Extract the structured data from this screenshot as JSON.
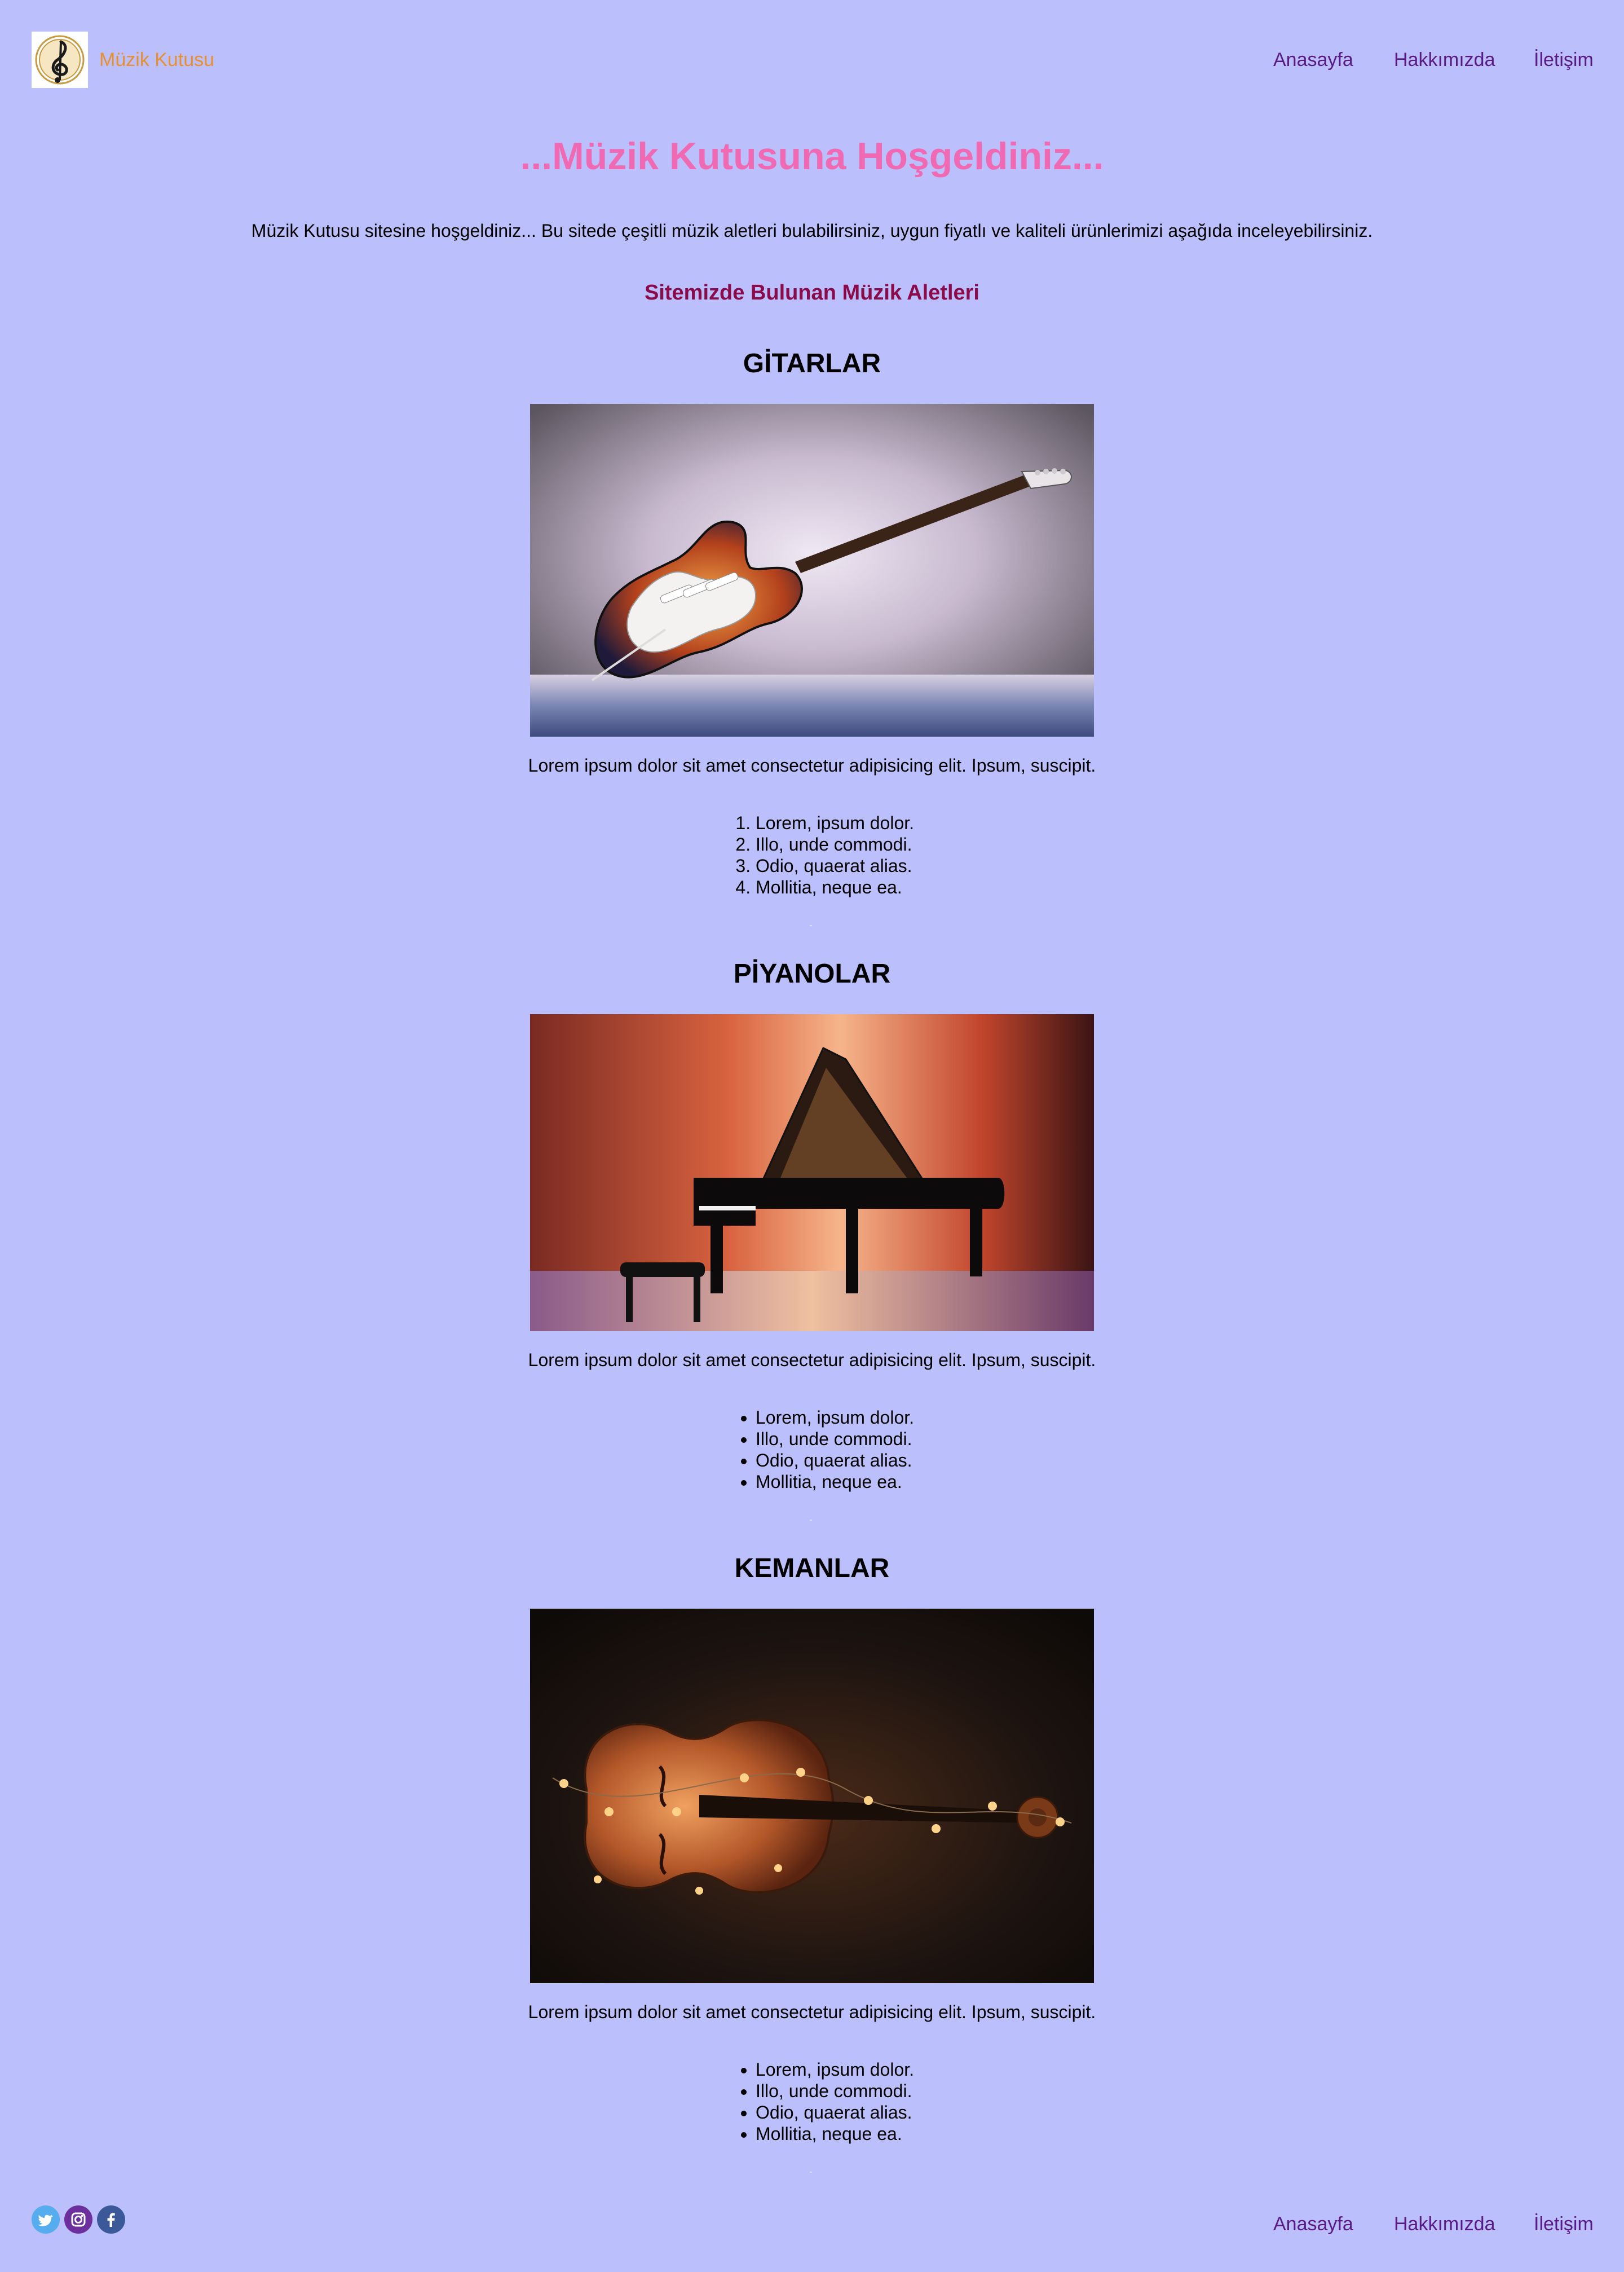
{
  "header": {
    "brand": "Müzik Kutusu",
    "logo_icon": "treble-clef-icon",
    "nav": [
      "Anasayfa",
      "Hakkımızda",
      "İletişim"
    ]
  },
  "main": {
    "title": "...Müzik Kutusuna Hoşgeldiniz...",
    "intro": "Müzik Kutusu sitesine hoşgeldiniz... Bu sitede çeşitli müzik aletleri bulabilirsiniz, uygun fiyatlı ve kaliteli ürünlerimizi aşağıda inceleyebilirsiniz.",
    "subtitle": "Sitemizde Bulunan Müzik Aletleri",
    "sections": [
      {
        "title": "GİTARLAR",
        "image": "electric-guitar-photo",
        "text": "Lorem ipsum dolor sit amet consectetur adipisicing elit. Ipsum, suscipit.",
        "list_type": "ordered",
        "items": [
          "Lorem, ipsum dolor.",
          "Illo, unde commodi.",
          "Odio, quaerat alias.",
          "Mollitia, neque ea."
        ]
      },
      {
        "title": "PİYANOLAR",
        "image": "grand-piano-photo",
        "text": "Lorem ipsum dolor sit amet consectetur adipisicing elit. Ipsum, suscipit.",
        "list_type": "unordered",
        "items": [
          "Lorem, ipsum dolor.",
          "Illo, unde commodi.",
          "Odio, quaerat alias.",
          "Mollitia, neque ea."
        ]
      },
      {
        "title": "KEMANLAR",
        "image": "violin-with-lights-photo",
        "text": "Lorem ipsum dolor sit amet consectetur adipisicing elit. Ipsum, suscipit.",
        "list_type": "unordered",
        "items": [
          "Lorem, ipsum dolor.",
          "Illo, unde commodi.",
          "Odio, quaerat alias.",
          "Mollitia, neque ea."
        ]
      }
    ]
  },
  "footer": {
    "social_icons": [
      "twitter-icon",
      "instagram-icon",
      "facebook-icon"
    ],
    "nav": [
      "Anasayfa",
      "Hakkımızda",
      "İletişim"
    ]
  },
  "colors": {
    "background": "#bbbffb",
    "brand": "#e8902f",
    "nav": "#5a1a86",
    "title": "#f06ab3",
    "subtitle": "#8a0a4a"
  }
}
